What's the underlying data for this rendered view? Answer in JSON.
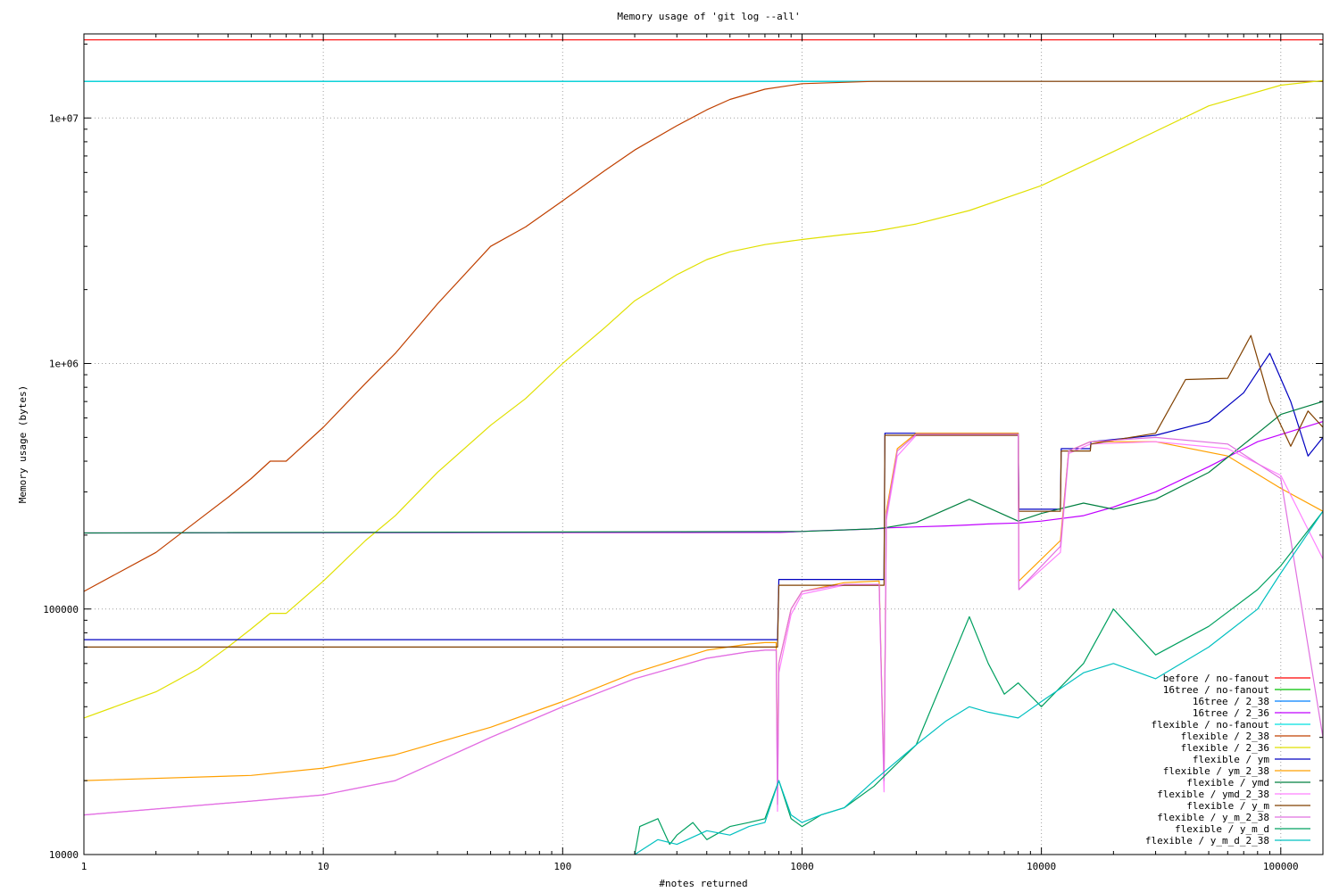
{
  "chart_data": {
    "type": "line",
    "title": "Memory usage of 'git log --all'",
    "xlabel": "#notes returned",
    "ylabel": "Memory usage (bytes)",
    "x_scale": "log",
    "y_scale": "log",
    "xlim": [
      1,
      150000
    ],
    "ylim": [
      10000,
      22000000
    ],
    "grid": true,
    "legend_position": "bottom-right",
    "x_ticks": [
      {
        "value": 1,
        "label": "1"
      },
      {
        "value": 10,
        "label": "10"
      },
      {
        "value": 100,
        "label": "100"
      },
      {
        "value": 1000,
        "label": "1000"
      },
      {
        "value": 10000,
        "label": "10000"
      },
      {
        "value": 100000,
        "label": "100000"
      }
    ],
    "y_ticks": [
      {
        "value": 10000,
        "label": "10000"
      },
      {
        "value": 100000,
        "label": "100000"
      },
      {
        "value": 1000000,
        "label": "1e+06"
      },
      {
        "value": 10000000,
        "label": "1e+07"
      }
    ],
    "series": [
      {
        "name": "before / no-fanout",
        "color": "#ff0000",
        "x": [
          1,
          150000
        ],
        "y": [
          20800000,
          20800000
        ]
      },
      {
        "name": "16tree / no-fanout",
        "color": "#00c000",
        "x": [
          1,
          150000
        ],
        "y": [
          14100000,
          14100000
        ]
      },
      {
        "name": "16tree / 2_38",
        "color": "#0080ff",
        "x": [
          1,
          150000
        ],
        "y": [
          14100000,
          14100000
        ]
      },
      {
        "name": "16tree / 2_36",
        "color": "#c000ff",
        "x": [
          1,
          800,
          810,
          900,
          1000,
          1100,
          1500,
          2000,
          2200,
          2250,
          3000,
          4000,
          5000,
          6000,
          8000,
          10000,
          15000,
          20000,
          30000,
          50000,
          80000,
          150000
        ],
        "y": [
          204000,
          205000,
          205000,
          206000,
          207000,
          208000,
          210000,
          212000,
          213000,
          214000,
          216000,
          218000,
          220000,
          222000,
          224000,
          228000,
          240000,
          260000,
          300000,
          380000,
          480000,
          580000
        ]
      },
      {
        "name": "flexible / no-fanout",
        "color": "#00e0e0",
        "x": [
          1,
          150000
        ],
        "y": [
          14100000,
          14100000
        ]
      },
      {
        "name": "flexible / 2_38",
        "color": "#c04000",
        "x": [
          1,
          2,
          3,
          4,
          5,
          6,
          7,
          10,
          15,
          20,
          30,
          50,
          70,
          100,
          150,
          200,
          300,
          400,
          500,
          700,
          1000,
          2000,
          150000
        ],
        "y": [
          118000,
          170000,
          230000,
          285000,
          340000,
          400000,
          400000,
          550000,
          830000,
          1100000,
          1750000,
          3000000,
          3600000,
          4600000,
          6100000,
          7400000,
          9300000,
          10800000,
          11900000,
          13100000,
          13800000,
          14100000,
          14100000
        ]
      },
      {
        "name": "flexible / 2_36",
        "color": "#e0e000",
        "x": [
          1,
          2,
          3,
          4,
          5,
          6,
          7,
          10,
          15,
          20,
          30,
          50,
          70,
          100,
          150,
          200,
          300,
          400,
          500,
          700,
          1000,
          1500,
          2000,
          3000,
          5000,
          10000,
          20000,
          50000,
          100000,
          150000
        ],
        "y": [
          36000,
          46000,
          57000,
          70000,
          83000,
          96000,
          96000,
          130000,
          190000,
          240000,
          360000,
          560000,
          720000,
          1000000,
          1400000,
          1800000,
          2300000,
          2650000,
          2850000,
          3050000,
          3200000,
          3350000,
          3450000,
          3700000,
          4200000,
          5300000,
          7300000,
          11200000,
          13600000,
          14200000
        ]
      },
      {
        "name": "flexible / ym",
        "color": "#0000c0",
        "x": [
          1,
          790,
          800,
          2200,
          2220,
          3000,
          8000,
          8050,
          12000,
          12100,
          16000,
          16100,
          30000,
          50000,
          70000,
          90000,
          110000,
          130000,
          150000
        ],
        "y": [
          75000,
          75000,
          132000,
          132000,
          520000,
          520000,
          520000,
          255000,
          255000,
          450000,
          450000,
          480000,
          510000,
          580000,
          760000,
          1100000,
          700000,
          420000,
          500000
        ]
      },
      {
        "name": "flexible / ym_2_38",
        "color": "#ffa000",
        "x": [
          1,
          5,
          10,
          20,
          50,
          100,
          200,
          400,
          600,
          700,
          780,
          790,
          800,
          900,
          1000,
          1500,
          2100,
          2200,
          2250,
          2500,
          3000,
          8000,
          8050,
          12000,
          13000,
          16000,
          30000,
          60000,
          100000,
          150000
        ],
        "y": [
          20000,
          21000,
          22500,
          25500,
          33000,
          42000,
          55000,
          68000,
          72000,
          73000,
          73000,
          20000,
          60000,
          100000,
          118000,
          128000,
          130000,
          20000,
          250000,
          450000,
          520000,
          520000,
          130000,
          190000,
          440000,
          480000,
          480000,
          420000,
          310000,
          250000
        ]
      },
      {
        "name": "flexible / ymd",
        "color": "#008040",
        "x": [
          1,
          1000,
          2000,
          2200,
          3000,
          5000,
          8000,
          10000,
          15000,
          20000,
          30000,
          50000,
          80000,
          100000,
          150000
        ],
        "y": [
          204000,
          207000,
          212000,
          214000,
          225000,
          280000,
          228000,
          245000,
          270000,
          255000,
          280000,
          360000,
          520000,
          620000,
          700000
        ]
      },
      {
        "name": "flexible / ymd_2_38",
        "color": "#ff80ff",
        "x": [
          1,
          5,
          10,
          20,
          50,
          100,
          200,
          400,
          600,
          700,
          780,
          790,
          800,
          900,
          1000,
          1500,
          2100,
          2200,
          2250,
          2500,
          3000,
          8000,
          8050,
          12000,
          13000,
          16000,
          30000,
          60000,
          100000,
          150000
        ],
        "y": [
          14500,
          16500,
          17500,
          20000,
          30000,
          40000,
          52000,
          63000,
          67000,
          68000,
          68000,
          15000,
          55000,
          95000,
          115000,
          125000,
          125000,
          18000,
          230000,
          420000,
          510000,
          510000,
          120000,
          170000,
          430000,
          470000,
          480000,
          450000,
          350000,
          160000
        ]
      },
      {
        "name": "flexible / y_m",
        "color": "#804000",
        "x": [
          1,
          790,
          800,
          2200,
          2220,
          3000,
          8000,
          8050,
          12000,
          12100,
          16000,
          16100,
          30000,
          40000,
          60000,
          75000,
          90000,
          110000,
          130000,
          150000
        ],
        "y": [
          70000,
          70000,
          125000,
          125000,
          510000,
          510000,
          510000,
          250000,
          250000,
          440000,
          440000,
          470000,
          520000,
          860000,
          870000,
          1300000,
          700000,
          460000,
          640000,
          550000
        ]
      },
      {
        "name": "flexible / y_m_2_38",
        "color": "#e070e0",
        "x": [
          1,
          5,
          10,
          20,
          50,
          100,
          200,
          400,
          600,
          700,
          780,
          790,
          800,
          900,
          1000,
          1500,
          2100,
          2200,
          2250,
          2500,
          3000,
          8000,
          8050,
          12000,
          13000,
          16000,
          30000,
          60000,
          100000,
          150000
        ],
        "y": [
          14500,
          16500,
          17500,
          20000,
          30000,
          40000,
          52000,
          63000,
          67000,
          68000,
          68000,
          16000,
          60000,
          100000,
          118000,
          126000,
          126000,
          20000,
          240000,
          440000,
          515000,
          515000,
          120000,
          180000,
          440000,
          480000,
          500000,
          470000,
          340000,
          30000
        ]
      },
      {
        "name": "flexible / y_m_d",
        "color": "#00a060",
        "x": [
          200,
          210,
          250,
          280,
          300,
          350,
          400,
          500,
          600,
          700,
          800,
          900,
          1000,
          1200,
          1500,
          2000,
          3000,
          4000,
          5000,
          6000,
          7000,
          8000,
          10000,
          15000,
          20000,
          30000,
          50000,
          80000,
          100000,
          150000
        ],
        "y": [
          10000,
          13000,
          14000,
          11000,
          12000,
          13500,
          11500,
          13000,
          13500,
          14000,
          20000,
          14000,
          13000,
          14500,
          15500,
          19000,
          28000,
          55000,
          93000,
          60000,
          45000,
          50000,
          40000,
          60000,
          100000,
          65000,
          85000,
          120000,
          150000,
          250000
        ]
      },
      {
        "name": "flexible / y_m_d_2_38",
        "color": "#00c0c0",
        "x": [
          200,
          250,
          300,
          400,
          500,
          600,
          700,
          800,
          900,
          1000,
          1200,
          1500,
          2000,
          3000,
          4000,
          5000,
          6000,
          8000,
          10000,
          15000,
          20000,
          30000,
          50000,
          80000,
          100000,
          150000
        ],
        "y": [
          10000,
          11500,
          11000,
          12500,
          12000,
          13000,
          13500,
          20000,
          14500,
          13500,
          14500,
          15500,
          20000,
          28000,
          35000,
          40000,
          38000,
          36000,
          42000,
          55000,
          60000,
          52000,
          70000,
          100000,
          140000,
          250000
        ]
      }
    ]
  }
}
